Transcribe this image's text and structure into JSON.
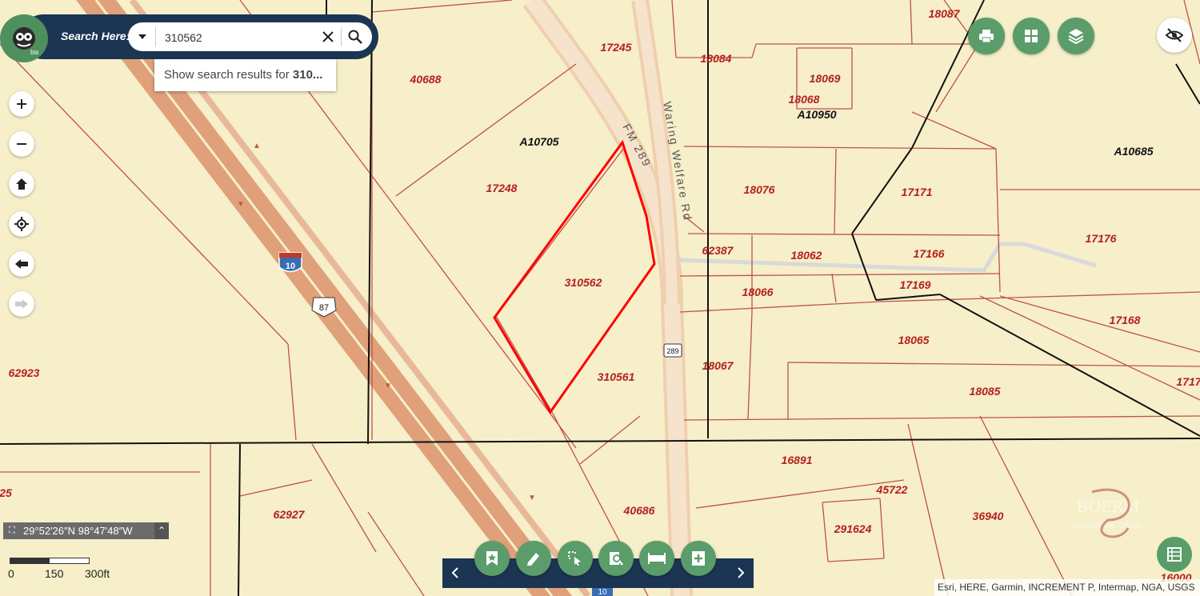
{
  "search": {
    "label": "Search Here:",
    "value": "310562",
    "suggestion_prefix": "Show search results for ",
    "suggestion_term": "310..."
  },
  "map": {
    "parcels": [
      {
        "id": "18087"
      },
      {
        "id": "17245"
      },
      {
        "id": "18084"
      },
      {
        "id": "40688"
      },
      {
        "id": "18069"
      },
      {
        "id": "18068"
      },
      {
        "id": "A10950",
        "type": "abstract"
      },
      {
        "id": "A10705",
        "type": "abstract"
      },
      {
        "id": "A10685",
        "type": "abstract"
      },
      {
        "id": "17248"
      },
      {
        "id": "18076"
      },
      {
        "id": "17171"
      },
      {
        "id": "62387"
      },
      {
        "id": "18062"
      },
      {
        "id": "17166"
      },
      {
        "id": "17176"
      },
      {
        "id": "310562",
        "selected": true
      },
      {
        "id": "17169"
      },
      {
        "id": "18066"
      },
      {
        "id": "17168"
      },
      {
        "id": "18065"
      },
      {
        "id": "62923"
      },
      {
        "id": "310561"
      },
      {
        "id": "18067"
      },
      {
        "id": "18085"
      },
      {
        "id": "1717"
      },
      {
        "id": "16891"
      },
      {
        "id": "45722"
      },
      {
        "id": "25"
      },
      {
        "id": "62927"
      },
      {
        "id": "40686"
      },
      {
        "id": "291624"
      },
      {
        "id": "36940"
      },
      {
        "id": "16000"
      }
    ],
    "roads": {
      "fm": "FM 289",
      "waring": "Waring Welfare Rd",
      "interstate_shield": "10",
      "us_shield": "87",
      "fm_shield": "289",
      "interstate_shield_bottom": "10"
    },
    "colors": {
      "background": "#f6efc9",
      "parcel_line": "#c0504d",
      "boundary_line": "#111111",
      "selected": "#ff0000",
      "highway": "#e0a07a",
      "accent_green": "#5a9c6a",
      "navy": "#1b3553"
    }
  },
  "coordinates": "29°52′26″N 98°47′48″W",
  "scale": {
    "labels": [
      "0",
      "150",
      "300ft"
    ]
  },
  "attribution": "Esri, HERE, Garmin, INCREMENT P, Intermap, NGA, USGS",
  "watermark": {
    "text1": "BOERM",
    "text2": "COMMERCIAL GROUP"
  },
  "icons": {
    "logo": "bis-logo",
    "zoom_in": "plus-icon",
    "zoom_out": "minus-icon",
    "home": "home-icon",
    "locate": "locate-icon",
    "back": "arrow-left-icon",
    "forward": "arrow-right-icon",
    "print": "printer-icon",
    "basemap": "grid-icon",
    "layers": "layers-icon",
    "hide": "eye-off-icon",
    "table": "table-icon"
  },
  "toolbar": {
    "buttons": [
      "bookmark",
      "draw",
      "select",
      "identify",
      "measure",
      "add-data"
    ]
  }
}
